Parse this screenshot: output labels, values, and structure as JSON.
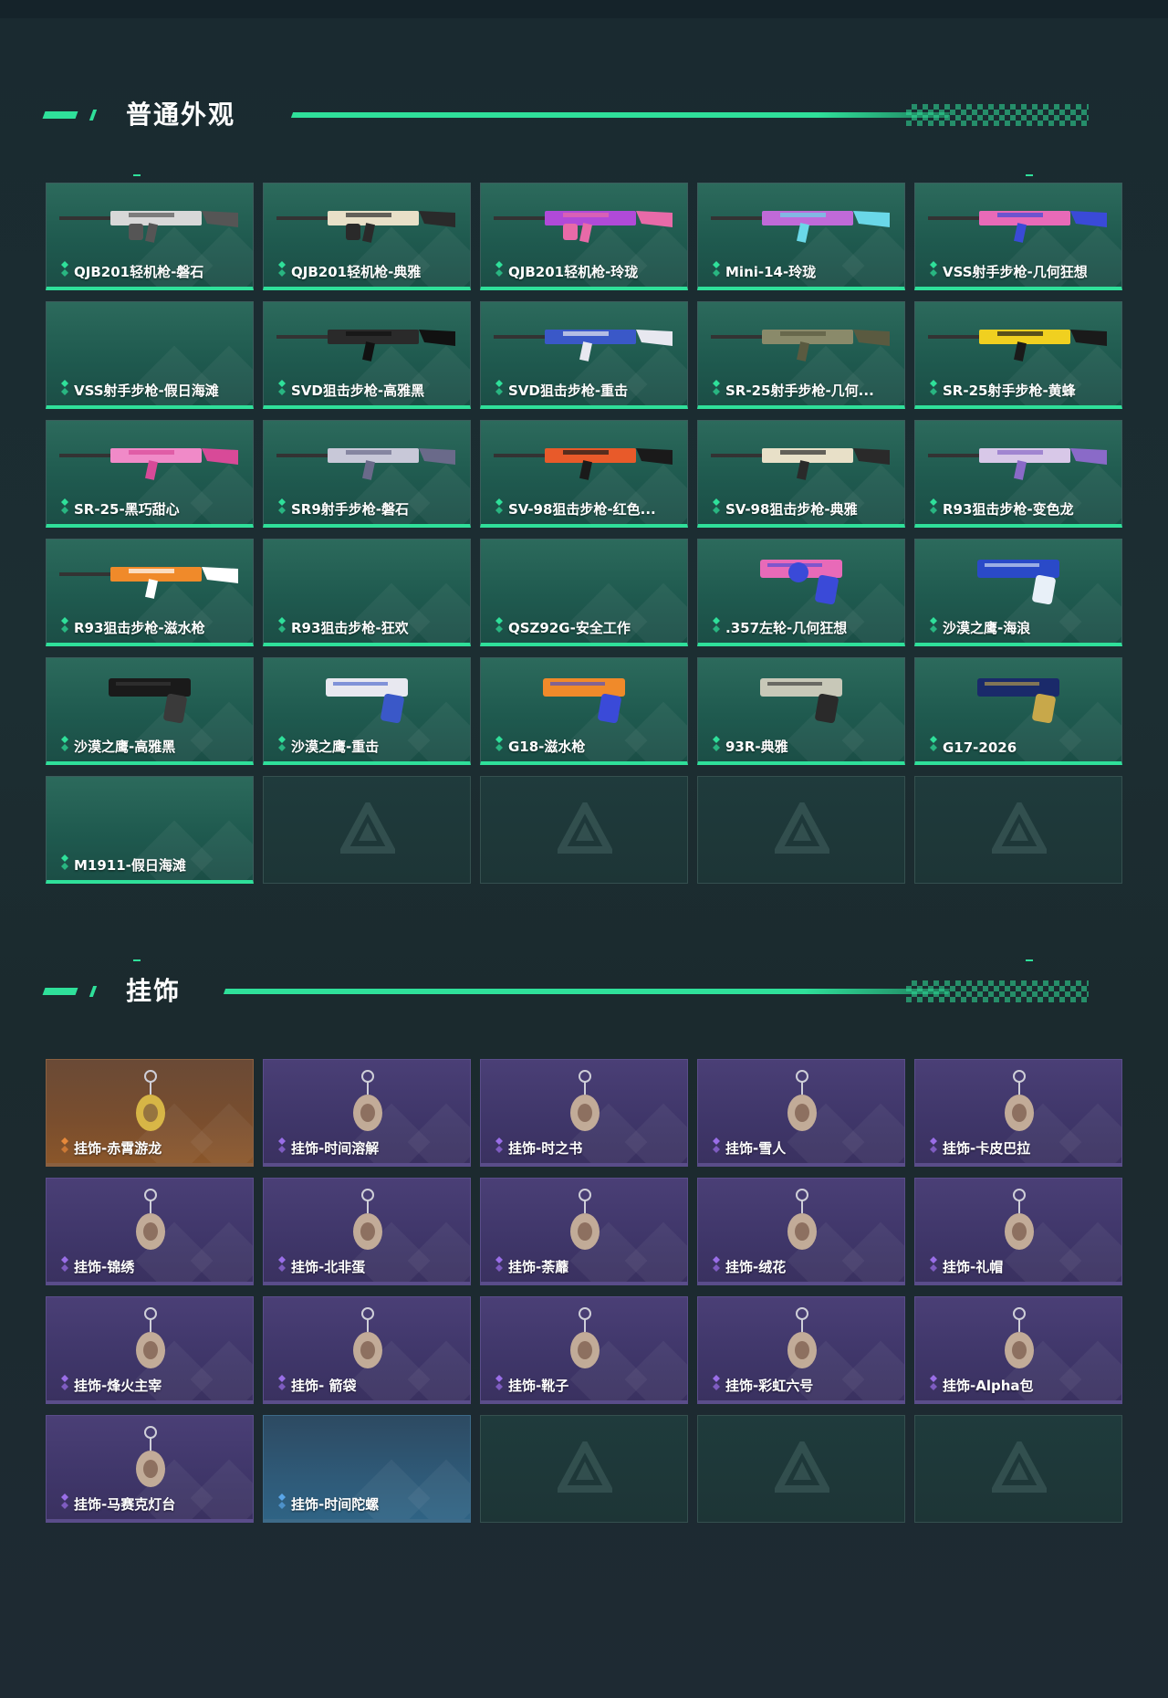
{
  "sections": {
    "skins": {
      "title": "普通外观",
      "items": [
        {
          "label": "QJB201轻机枪-磐石",
          "icon": "lmg-icon",
          "colors": [
            "#d8d8d8",
            "#555555"
          ]
        },
        {
          "label": "QJB201轻机枪-典雅",
          "icon": "lmg-icon",
          "colors": [
            "#e8e0c8",
            "#2a2a2a"
          ]
        },
        {
          "label": "QJB201轻机枪-玲珑",
          "icon": "lmg-icon",
          "colors": [
            "#b04ad8",
            "#e86aa8"
          ]
        },
        {
          "label": "Mini-14-玲珑",
          "icon": "rifle-icon",
          "colors": [
            "#c06ad8",
            "#6ad8e8"
          ]
        },
        {
          "label": "VSS射手步枪-几何狂想",
          "icon": "marksman-rifle-icon",
          "colors": [
            "#e86ab8",
            "#3a4ad8"
          ]
        },
        {
          "label": "VSS射手步枪-假日海滩",
          "icon": "empty-icon",
          "colors": []
        },
        {
          "label": "SVD狙击步枪-高雅黑",
          "icon": "sniper-rifle-icon",
          "colors": [
            "#2a2a2a",
            "#111111"
          ]
        },
        {
          "label": "SVD狙击步枪-重击",
          "icon": "sniper-rifle-icon",
          "colors": [
            "#3a58c8",
            "#e8e8f0"
          ]
        },
        {
          "label": "SR-25射手步枪-几何...",
          "icon": "marksman-rifle-icon",
          "colors": [
            "#8a8a6a",
            "#5a5a40"
          ]
        },
        {
          "label": "SR-25射手步枪-黄蜂",
          "icon": "marksman-rifle-icon",
          "colors": [
            "#f0d020",
            "#1a1a1a"
          ]
        },
        {
          "label": "SR-25-黑巧甜心",
          "icon": "marksman-rifle-icon",
          "colors": [
            "#f08ac8",
            "#d84a98"
          ]
        },
        {
          "label": "SR9射手步枪-磐石",
          "icon": "marksman-rifle-icon",
          "colors": [
            "#c8c8d8",
            "#6a6a8a"
          ]
        },
        {
          "label": "SV-98狙击步枪-红色...",
          "icon": "sniper-rifle-icon",
          "colors": [
            "#e85a2a",
            "#1a1a1a"
          ]
        },
        {
          "label": "SV-98狙击步枪-典雅",
          "icon": "sniper-rifle-icon",
          "colors": [
            "#e8e0c8",
            "#2a2a2a"
          ]
        },
        {
          "label": "R93狙击步枪-变色龙",
          "icon": "sniper-rifle-icon",
          "colors": [
            "#d8c8e8",
            "#8a6ac8"
          ]
        },
        {
          "label": "R93狙击步枪-滋水枪",
          "icon": "sniper-rifle-icon",
          "colors": [
            "#f08a2a",
            "#ffffff"
          ]
        },
        {
          "label": "R93狙击步枪-狂欢",
          "icon": "empty-icon",
          "colors": []
        },
        {
          "label": "QSZ92G-安全工作",
          "icon": "empty-icon",
          "colors": []
        },
        {
          "label": ".357左轮-几何狂想",
          "icon": "revolver-icon",
          "colors": [
            "#e86ab8",
            "#3a4ad8"
          ]
        },
        {
          "label": "沙漠之鹰-海浪",
          "icon": "pistol-icon",
          "colors": [
            "#2a4ac8",
            "#e8f0f8"
          ]
        },
        {
          "label": "沙漠之鹰-高雅黑",
          "icon": "pistol-icon",
          "colors": [
            "#1a1a1a",
            "#3a3a3a"
          ]
        },
        {
          "label": "沙漠之鹰-重击",
          "icon": "pistol-icon",
          "colors": [
            "#e8e8f0",
            "#3a58c8"
          ]
        },
        {
          "label": "G18-滋水枪",
          "icon": "pistol-icon",
          "colors": [
            "#f08a2a",
            "#3a4ad8"
          ]
        },
        {
          "label": "93R-典雅",
          "icon": "pistol-icon",
          "colors": [
            "#c8c8b8",
            "#2a2a2a"
          ]
        },
        {
          "label": "G17-2026",
          "icon": "pistol-icon",
          "colors": [
            "#1a2a6a",
            "#c8a84a"
          ]
        },
        {
          "label": "M1911-假日海滩",
          "icon": "empty-icon",
          "colors": []
        }
      ]
    },
    "charms": {
      "title": "挂饰",
      "items": [
        {
          "label": "挂饰-赤霄游龙",
          "rarity": "orange",
          "icon": "dragon-charm-icon"
        },
        {
          "label": "挂饰-时间溶解",
          "rarity": "purple",
          "icon": "clock-charm-icon"
        },
        {
          "label": "挂饰-时之书",
          "rarity": "purple",
          "icon": "book-charm-icon"
        },
        {
          "label": "挂饰-雪人",
          "rarity": "purple",
          "icon": "snowman-charm-icon"
        },
        {
          "label": "挂饰-卡皮巴拉",
          "rarity": "purple",
          "icon": "capybara-charm-icon"
        },
        {
          "label": "挂饰-锦绣",
          "rarity": "purple",
          "icon": "butterfly-charm-icon"
        },
        {
          "label": "挂饰-北非蛋",
          "rarity": "purple",
          "icon": "egg-dish-charm-icon"
        },
        {
          "label": "挂饰-荼蘼",
          "rarity": "purple",
          "icon": "flower-charm-icon"
        },
        {
          "label": "挂饰-绒花",
          "rarity": "purple",
          "icon": "rose-charm-icon"
        },
        {
          "label": "挂饰-礼帽",
          "rarity": "purple",
          "icon": "hat-charm-icon"
        },
        {
          "label": "挂饰-烽火主宰",
          "rarity": "purple",
          "icon": "container-charm-icon"
        },
        {
          "label": "挂饰- 箭袋",
          "rarity": "purple",
          "icon": "quiver-charm-icon"
        },
        {
          "label": "挂饰-靴子",
          "rarity": "purple",
          "icon": "boot-charm-icon"
        },
        {
          "label": "挂饰-彩虹六号",
          "rarity": "purple",
          "icon": "rainbow-six-charm-icon"
        },
        {
          "label": "挂饰-Alpha包",
          "rarity": "purple",
          "icon": "bag-charm-icon"
        },
        {
          "label": "挂饰-马赛克灯台",
          "rarity": "purple",
          "icon": "lantern-charm-icon"
        },
        {
          "label": "挂饰-时间陀螺",
          "rarity": "blue",
          "icon": "empty-icon"
        }
      ]
    }
  },
  "colors": {
    "accent": "#2fe09a",
    "purple": "#9a6ee8",
    "orange": "#e8893a",
    "blue": "#5aa6e8"
  }
}
